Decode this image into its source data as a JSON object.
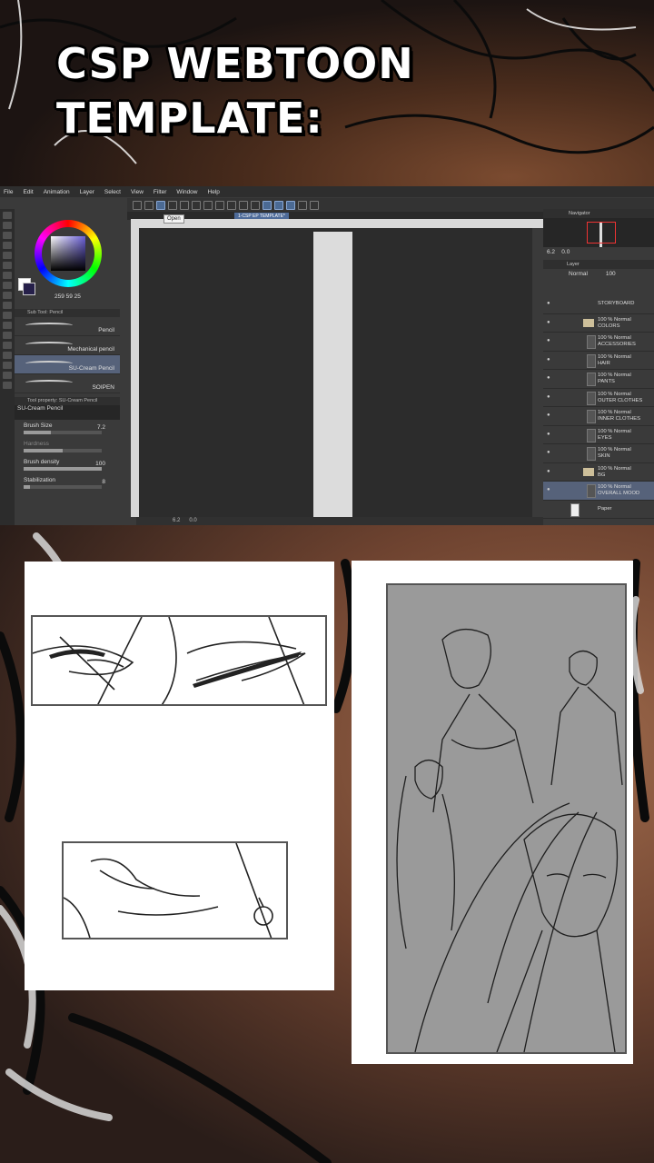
{
  "title": {
    "line1": "CSP WEBTOON",
    "line2": "TEMPLATE:"
  },
  "app": {
    "menu": [
      "File",
      "Edit",
      "Animation",
      "Layer",
      "Select",
      "View",
      "Filter",
      "Window",
      "Help"
    ],
    "tooltip": "Open",
    "document_tab": "1-CSP EP TEMPLATE*",
    "color_values": "259 59 25",
    "sub_tool_header": "Sub Tool: Pencil",
    "brushes": [
      {
        "label": "Pencil",
        "selected": false
      },
      {
        "label": "Mechanical pencil",
        "selected": false
      },
      {
        "label": "SU-Cream Pencil",
        "selected": true
      },
      {
        "label": "SOIPEN",
        "selected": false
      }
    ],
    "tool_property_header": "Tool property: SU-Cream Pencil",
    "tool_property_name": "SU-Cream Pencil",
    "properties": [
      {
        "label": "Brush Size",
        "value": "7.2",
        "fill": 0.35,
        "dim": false
      },
      {
        "label": "Hardness",
        "value": "",
        "fill": 0.5,
        "dim": true
      },
      {
        "label": "Brush density",
        "value": "100",
        "fill": 1.0,
        "dim": false
      },
      {
        "label": "Stabilization",
        "value": "8",
        "fill": 0.08,
        "dim": false
      }
    ],
    "status_zoom": "6.2",
    "status_angle": "0.0",
    "navigator_header": "Navigator",
    "nav_zoom": "6.2",
    "nav_angle": "0.0",
    "layer_header": "Layer",
    "blend_mode": "Normal",
    "opacity": "100",
    "layers": [
      {
        "line1": "STORYBOARD",
        "line2": "",
        "type": "plain",
        "selected": false
      },
      {
        "line1": "100 % Normal",
        "line2": "COLORS",
        "type": "folder",
        "selected": false
      },
      {
        "line1": "100 % Normal",
        "line2": "ACCESSORIES",
        "type": "layer",
        "selected": false
      },
      {
        "line1": "100 % Normal",
        "line2": "HAIR",
        "type": "layer",
        "selected": false
      },
      {
        "line1": "100 % Normal",
        "line2": "PANTS",
        "type": "layer",
        "selected": false
      },
      {
        "line1": "100 % Normal",
        "line2": "OUTER CLOTHES",
        "type": "layer",
        "selected": false
      },
      {
        "line1": "100 % Normal",
        "line2": "INNER CLOTHES",
        "type": "layer",
        "selected": false
      },
      {
        "line1": "100 % Normal",
        "line2": "EYES",
        "type": "layer",
        "selected": false
      },
      {
        "line1": "100 % Normal",
        "line2": "SKIN",
        "type": "layer",
        "selected": false
      },
      {
        "line1": "100 % Normal",
        "line2": "BG",
        "type": "folder",
        "selected": false
      },
      {
        "line1": "100 % Normal",
        "line2": "OVERALL MOOD",
        "type": "layer",
        "selected": true
      },
      {
        "line1": "Paper",
        "line2": "",
        "type": "plain",
        "selected": false
      }
    ]
  },
  "colors": {
    "accent": "#56627a",
    "tab": "#4e6b99",
    "navigator_frame": "#ee3333"
  }
}
